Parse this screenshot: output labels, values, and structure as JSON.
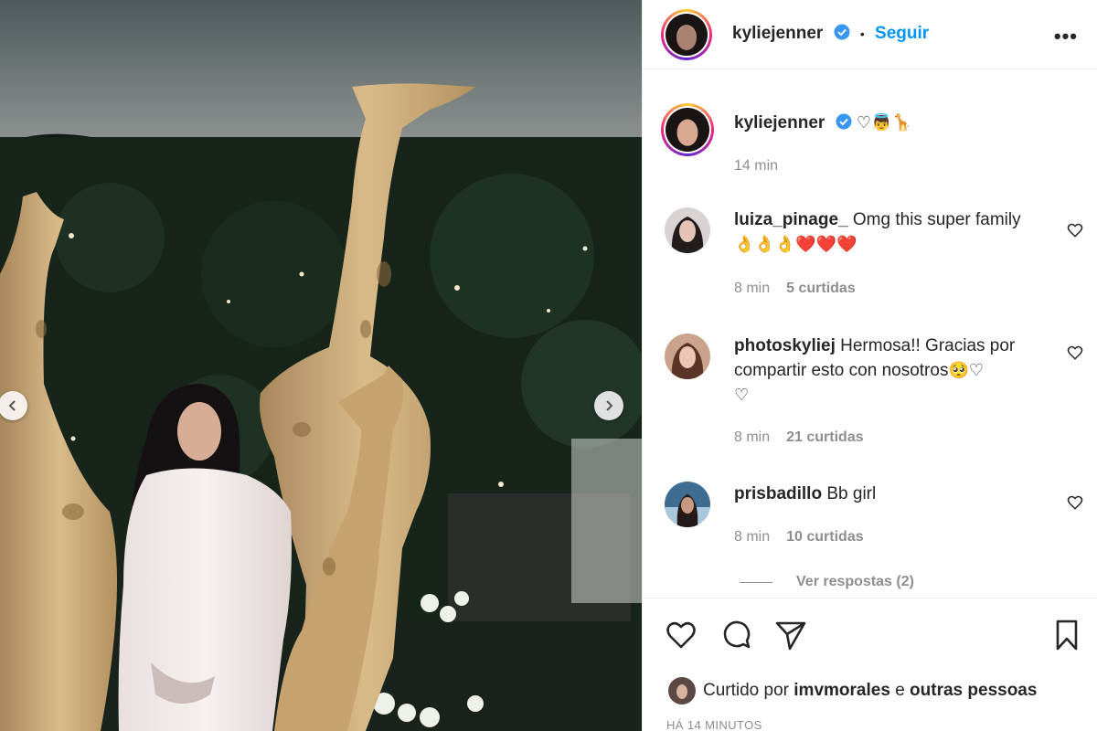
{
  "post": {
    "author": "kyliejenner",
    "follow_label": "Seguir",
    "more_label": "•••",
    "caption_emojis": "♡👼🦒",
    "caption_time": "14 min",
    "carousel": {
      "prev_label": "previous",
      "next_label": "next"
    }
  },
  "comments": [
    {
      "user": "luiza_pinage_",
      "text": "Omg this super family",
      "emojis": "👌👌👌❤️❤️❤️",
      "time": "8 min",
      "likes": "5 curtidas"
    },
    {
      "user": "photoskyliej",
      "text": "Hermosa!! Gracias por compartir esto con nosotros",
      "emojis": "🥺♡",
      "emojis2": "♡",
      "time": "8 min",
      "likes": "21 curtidas"
    },
    {
      "user": "prisbadillo",
      "text": "Bb girl",
      "time": "8 min",
      "likes": "10 curtidas"
    }
  ],
  "view_replies": "Ver respostas (2)",
  "liked_by": {
    "prefix": "Curtido por",
    "user": "imvmorales",
    "conj": "e",
    "others": "outras pessoas"
  },
  "timestamp": "HÁ 14 MINUTOS",
  "colors": {
    "accent": "#0095f6",
    "text": "#262626",
    "muted": "#8e8e8e",
    "verified": "#3897f0"
  }
}
